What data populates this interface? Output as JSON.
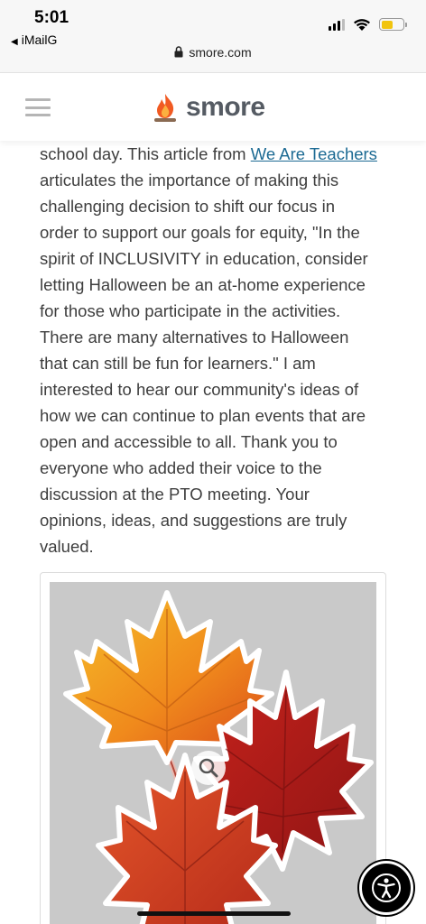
{
  "status_bar": {
    "time": "5:01",
    "back_app": "iMailG",
    "back_icon": "back-triangle-icon",
    "url": "smore.com",
    "battery_color": "#f1c40f"
  },
  "header": {
    "menu_icon": "hamburger-menu-icon",
    "logo_text": "smore",
    "logo_icon": "campfire-icon",
    "brand_color": "#555b63"
  },
  "article": {
    "lines": [
      "school day. This article from ",
      "articulates the importance of making this",
      "challenging decision to shift our focus in",
      "order to support our goals for equity, \"In the",
      "spirit of INCLUSIVITY in education, consider",
      "letting Halloween be an at-home experience",
      "for those who participate in the activities.",
      "There are many alternatives to Halloween",
      "that can still be fun for learners.\" I am",
      "interested to hear our community's ideas of",
      "how we can continue to plan events that are",
      "open and accessible to all. Thank you to",
      "everyone who added their voice to the",
      "discussion at the PTO meeting. Your",
      "opinions, ideas, and suggestions are truly",
      "valued."
    ],
    "link_text": "We Are Teachers",
    "link_color": "#1c6a93"
  },
  "image": {
    "subject": "autumn maple leaves",
    "zoom_icon": "magnify-icon"
  },
  "overlay": {
    "accessibility_icon": "accessibility-person-icon"
  }
}
